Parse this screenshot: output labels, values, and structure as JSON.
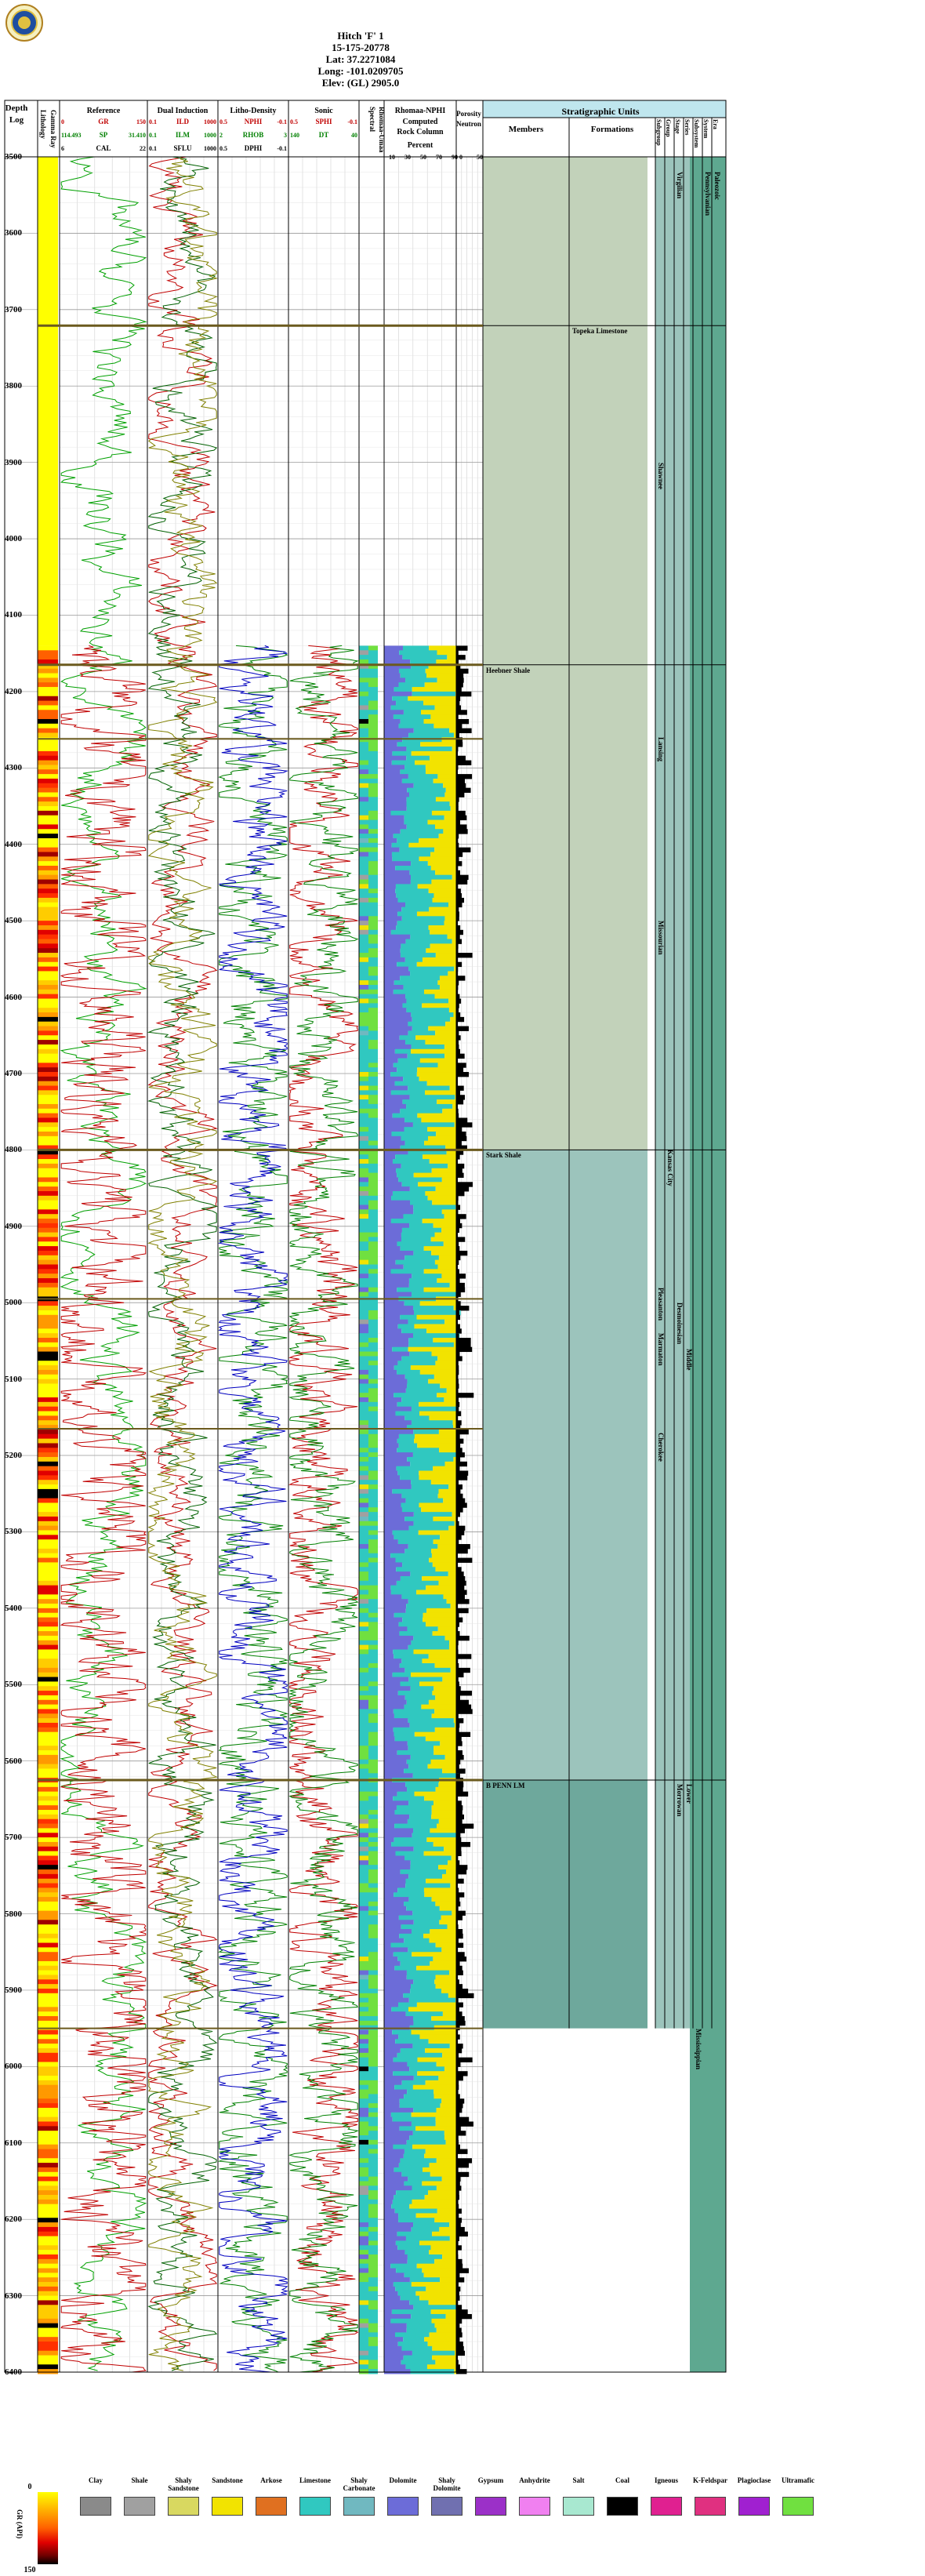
{
  "header": {
    "well_name": "Hitch 'F' 1",
    "api": "15-175-20778",
    "lat": "Lat: 37.2271084",
    "long": "Long: -101.0209705",
    "elev": "Elev: (GL) 2905.0"
  },
  "tracks": {
    "depth_title": "Depth",
    "depth_unit": "Log",
    "lithology": "Lithology",
    "gr_colorbar": "Gamma Ray",
    "reference": {
      "title": "Reference",
      "rows": [
        [
          "GR",
          "150",
          "0"
        ],
        [
          "SP",
          "31.410",
          "114.493"
        ],
        [
          "CAL",
          "22",
          "6"
        ]
      ]
    },
    "dual_induction": {
      "title": "Dual Induction",
      "rows": [
        [
          "ILD",
          "1000",
          "0.1"
        ],
        [
          "ILM",
          "1000",
          "0.1"
        ],
        [
          "SFLU",
          "1000",
          "0.1"
        ]
      ]
    },
    "litho_density": {
      "title": "Litho-Density",
      "rows": [
        [
          "NPHI",
          "-0.1",
          "0.5"
        ],
        [
          "RHOB",
          "3",
          "2"
        ],
        [
          "DPHI",
          "-0.1",
          "0.5"
        ]
      ]
    },
    "sonic": {
      "title": "Sonic",
      "rows": [
        [
          "SPHI",
          "-0.1",
          "0.5"
        ],
        [
          "DT",
          "40",
          "140"
        ]
      ]
    },
    "spectral": "Spectral",
    "rhomaa_umaa": "Rhomaa-Umaa",
    "rhomaa_nphi": {
      "title": "Rhomaa-NPHI",
      "sub1": "Computed",
      "sub2": "Rock Column",
      "sub3": "Percent",
      "ticks": [
        "10",
        "30",
        "50",
        "70",
        "90"
      ]
    },
    "porosity": {
      "title": "Porosity",
      "sub": "Neutron",
      "ticks": [
        "0",
        "50"
      ]
    },
    "strat": {
      "title": "Stratigraphic Units",
      "members": "Members",
      "formations": "Formations",
      "cols": [
        "Subgroup",
        "Group",
        "Stage",
        "Series",
        "Subsystem",
        "System",
        "Era"
      ]
    }
  },
  "depth_labels": [
    "3500",
    "3600",
    "3700",
    "3800",
    "3900",
    "4000",
    "4100",
    "4200",
    "4300",
    "4400",
    "4500",
    "4600",
    "4700",
    "4800",
    "4900",
    "5000",
    "5100",
    "5200",
    "5300",
    "5400",
    "5500",
    "5600",
    "5700",
    "5800",
    "5900",
    "6000",
    "6100",
    "6200",
    "6300",
    "6400"
  ],
  "tops": [
    {
      "name": "Topeka Limestone",
      "depth": 3721
    },
    {
      "name": "Heebner Shale",
      "depth": 4165
    },
    {
      "name": "Stark Shale",
      "depth": 4800
    },
    {
      "name": "B PENN LM",
      "depth": 5625
    }
  ],
  "extra_lines": [
    4262,
    4995,
    5165,
    5950
  ],
  "strat_labels": {
    "shawnee": "Shawnee",
    "lansing": "Lansing",
    "missourian": "Missourian",
    "kansas_city": "Kansas City",
    "pleasanton": "Pleasanton",
    "marmaton": "Marmaton",
    "desmoinesian": "Desmoinesian",
    "cherokee": "Cherokee",
    "middle": "Middle",
    "lower": "Lower",
    "morrowan": "Morrowan",
    "mississippian": "Mississippian",
    "pennsylvanian": "Pennsylvanian",
    "paleozoic": "Paleozoic",
    "virgilian": "Virgilian"
  },
  "legend": {
    "gr_label": "GR (API)",
    "gr_min": "0",
    "gr_max": "150",
    "items": [
      {
        "label": "Clay",
        "color": "#8a8a8a"
      },
      {
        "label": "Shale",
        "color": "#a0a0a0"
      },
      {
        "label": "Shaly Sandstone",
        "color": "#d8d860"
      },
      {
        "label": "Sandstone",
        "color": "#f2e300"
      },
      {
        "label": "Arkose",
        "color": "#e07020"
      },
      {
        "label": "Limestone",
        "color": "#30c8c0"
      },
      {
        "label": "Shaly Carbonate",
        "color": "#70b8c0"
      },
      {
        "label": "Dolomite",
        "color": "#6c6cd8"
      },
      {
        "label": "Shaly Dolomite",
        "color": "#7070b0"
      },
      {
        "label": "Gypsum",
        "color": "#9b30c8"
      },
      {
        "label": "Anhydrite",
        "color": "#f080f0"
      },
      {
        "label": "Salt",
        "color": "#a8e8d0"
      },
      {
        "label": "Coal",
        "color": "#000000"
      },
      {
        "label": "Igneous",
        "color": "#e02090"
      },
      {
        "label": "K-Feldspar",
        "color": "#e03080"
      },
      {
        "label": "Plagioclase",
        "color": "#a020d0"
      },
      {
        "label": "Ultramafic",
        "color": "#70e040"
      }
    ]
  }
}
